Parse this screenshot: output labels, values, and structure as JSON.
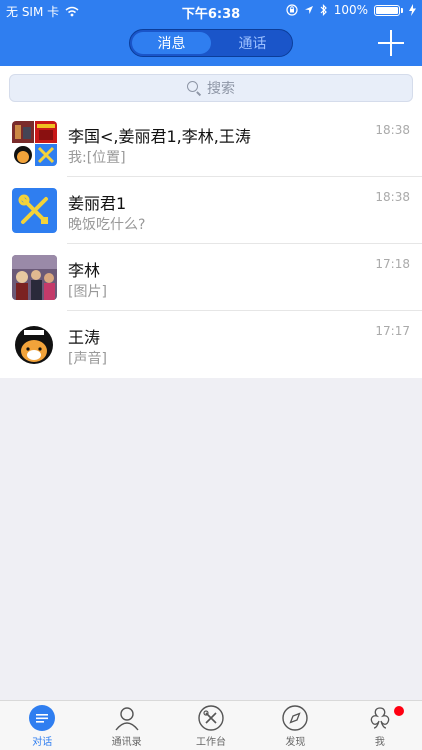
{
  "status_bar": {
    "carrier": "无 SIM 卡",
    "time": "下午6:38",
    "battery": "100%"
  },
  "header": {
    "tabs": [
      {
        "label": "消息",
        "active": true
      },
      {
        "label": "通话",
        "active": false
      }
    ],
    "add_icon": "plus-icon"
  },
  "search": {
    "placeholder": "搜索"
  },
  "conversations": [
    {
      "name": "李国<,姜丽君1,李林,王涛",
      "preview": "我:[位置]",
      "time": "18:38"
    },
    {
      "name": "姜丽君1",
      "preview": "晚饭吃什么?",
      "time": "18:38"
    },
    {
      "name": "李林",
      "preview": "[图片]",
      "time": "17:18"
    },
    {
      "name": "王涛",
      "preview": "[声音]",
      "time": "17:17"
    }
  ],
  "tabbar": {
    "items": [
      {
        "label": "对话",
        "icon": "chat-icon",
        "active": true
      },
      {
        "label": "通讯录",
        "icon": "contacts-icon",
        "active": false
      },
      {
        "label": "工作台",
        "icon": "tools-icon",
        "active": false
      },
      {
        "label": "发现",
        "icon": "compass-icon",
        "active": false
      },
      {
        "label": "我",
        "icon": "profile-icon",
        "active": false,
        "badge": true
      }
    ]
  },
  "colors": {
    "brand": "#2f7ef0",
    "badge": "#ff0011"
  }
}
